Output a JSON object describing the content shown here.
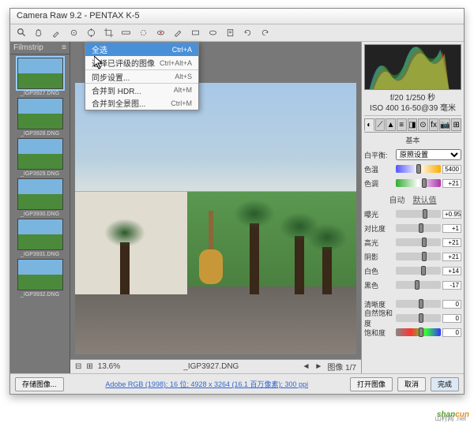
{
  "title": "Camera Raw 9.2  -  PENTAX K-5",
  "filmstrip": {
    "header": "Filmstrip",
    "items": [
      {
        "label": "_IGP3927.DNG",
        "sel": true
      },
      {
        "label": "_IGP3928.DNG"
      },
      {
        "label": "_IGP3929.DNG"
      },
      {
        "label": "_IGP3930.DNG"
      },
      {
        "label": "_IGP3931.DNG"
      },
      {
        "label": "_IGP3932.DNG"
      }
    ]
  },
  "menu": {
    "items": [
      {
        "label": "全选",
        "kb": "Ctrl+A",
        "hl": true
      },
      {
        "label": "选择已评级的图像",
        "kb": "Ctrl+Alt+A"
      },
      {
        "label": "同步设置...",
        "kb": "Alt+S",
        "sep": true
      },
      {
        "label": "合并到 HDR...",
        "kb": "Alt+M",
        "sep": true
      },
      {
        "label": "合并到全景图...",
        "kb": "Ctrl+M"
      }
    ]
  },
  "canvas": {
    "zoom": "13.6%",
    "filename": "_IGP3927.DNG",
    "nav": "图像 1/7"
  },
  "exif": {
    "line1": "f/20  1/250 秒",
    "line2": "ISO 400  16-50@39 毫米"
  },
  "panel": {
    "title": "基本",
    "wb_label": "白平衡:",
    "wb_value": "原照设置",
    "temp_label": "色温",
    "temp_val": "5400",
    "tint_label": "色调",
    "tint_val": "+21",
    "subtabs": {
      "auto": "自动",
      "default": "默认值"
    },
    "exposure_label": "曝光",
    "exposure_val": "+0.95",
    "contrast_label": "对比度",
    "contrast_val": "+1",
    "highlights_label": "高光",
    "highlights_val": "+21",
    "shadows_label": "阴影",
    "shadows_val": "+21",
    "whites_label": "白色",
    "whites_val": "+14",
    "blacks_label": "黑色",
    "blacks_val": "-17",
    "clarity_label": "清晰度",
    "clarity_val": "0",
    "vibrance_label": "自然饱和度",
    "vibrance_val": "0",
    "saturation_label": "饱和度",
    "saturation_val": "0"
  },
  "bottom": {
    "save": "存储图像...",
    "info": "Adobe RGB (1998): 16 位; 4928 x 3264 (16.1 百万像素); 300 ppi",
    "open": "打开图像",
    "cancel": "取消",
    "done": "完成"
  },
  "watermark": {
    "text": "shancun",
    "sub": "山村网 .net"
  }
}
